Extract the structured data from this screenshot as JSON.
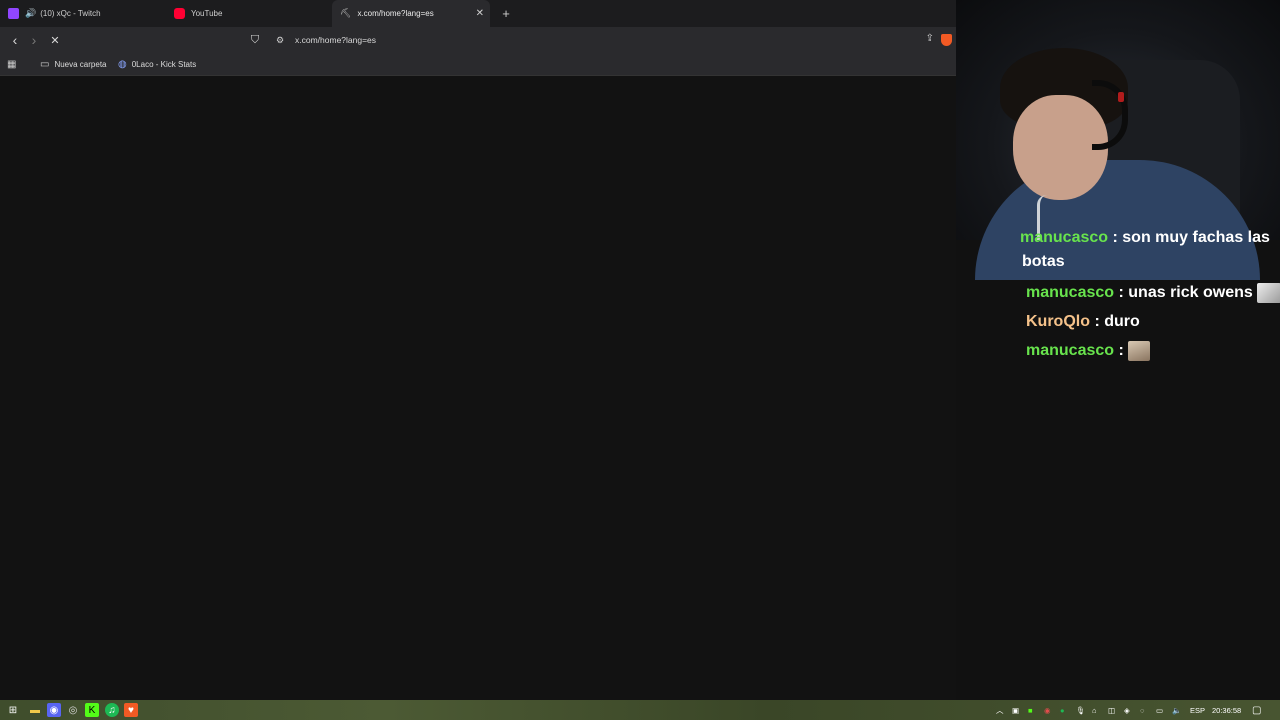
{
  "browser": {
    "tabs": [
      {
        "title": "(10) xQc - Twitch",
        "icon": "twitch-icon",
        "color": "#9146ff"
      },
      {
        "title": "YouTube",
        "icon": "youtube-icon",
        "color": "#ff0033"
      },
      {
        "title": "x.com/home?lang=es",
        "icon": "loading-icon",
        "active": true
      }
    ],
    "address": "x.com/home?lang=es",
    "bookmarks": [
      {
        "label": "Nueva carpeta",
        "icon": "folder-icon"
      },
      {
        "label": "0Laco - Kick Stats",
        "icon": "kick-stats-icon"
      }
    ]
  },
  "chat": {
    "messages": [
      {
        "user": "manucasco",
        "text": "son muy fachas las",
        "color": "#68e34d"
      },
      {
        "user": "",
        "text": "botas"
      },
      {
        "user": "manucasco",
        "text": "unas rick owens",
        "color": "#68e34d",
        "emote": true
      },
      {
        "user": "KuroQlo",
        "text": "duro",
        "color": "#f5c28a"
      },
      {
        "user": "manucasco",
        "text": "",
        "color": "#68e34d",
        "emote": true
      }
    ],
    "separator": ":"
  },
  "taskbar": {
    "language": "ESP",
    "time": "20:36:58"
  }
}
